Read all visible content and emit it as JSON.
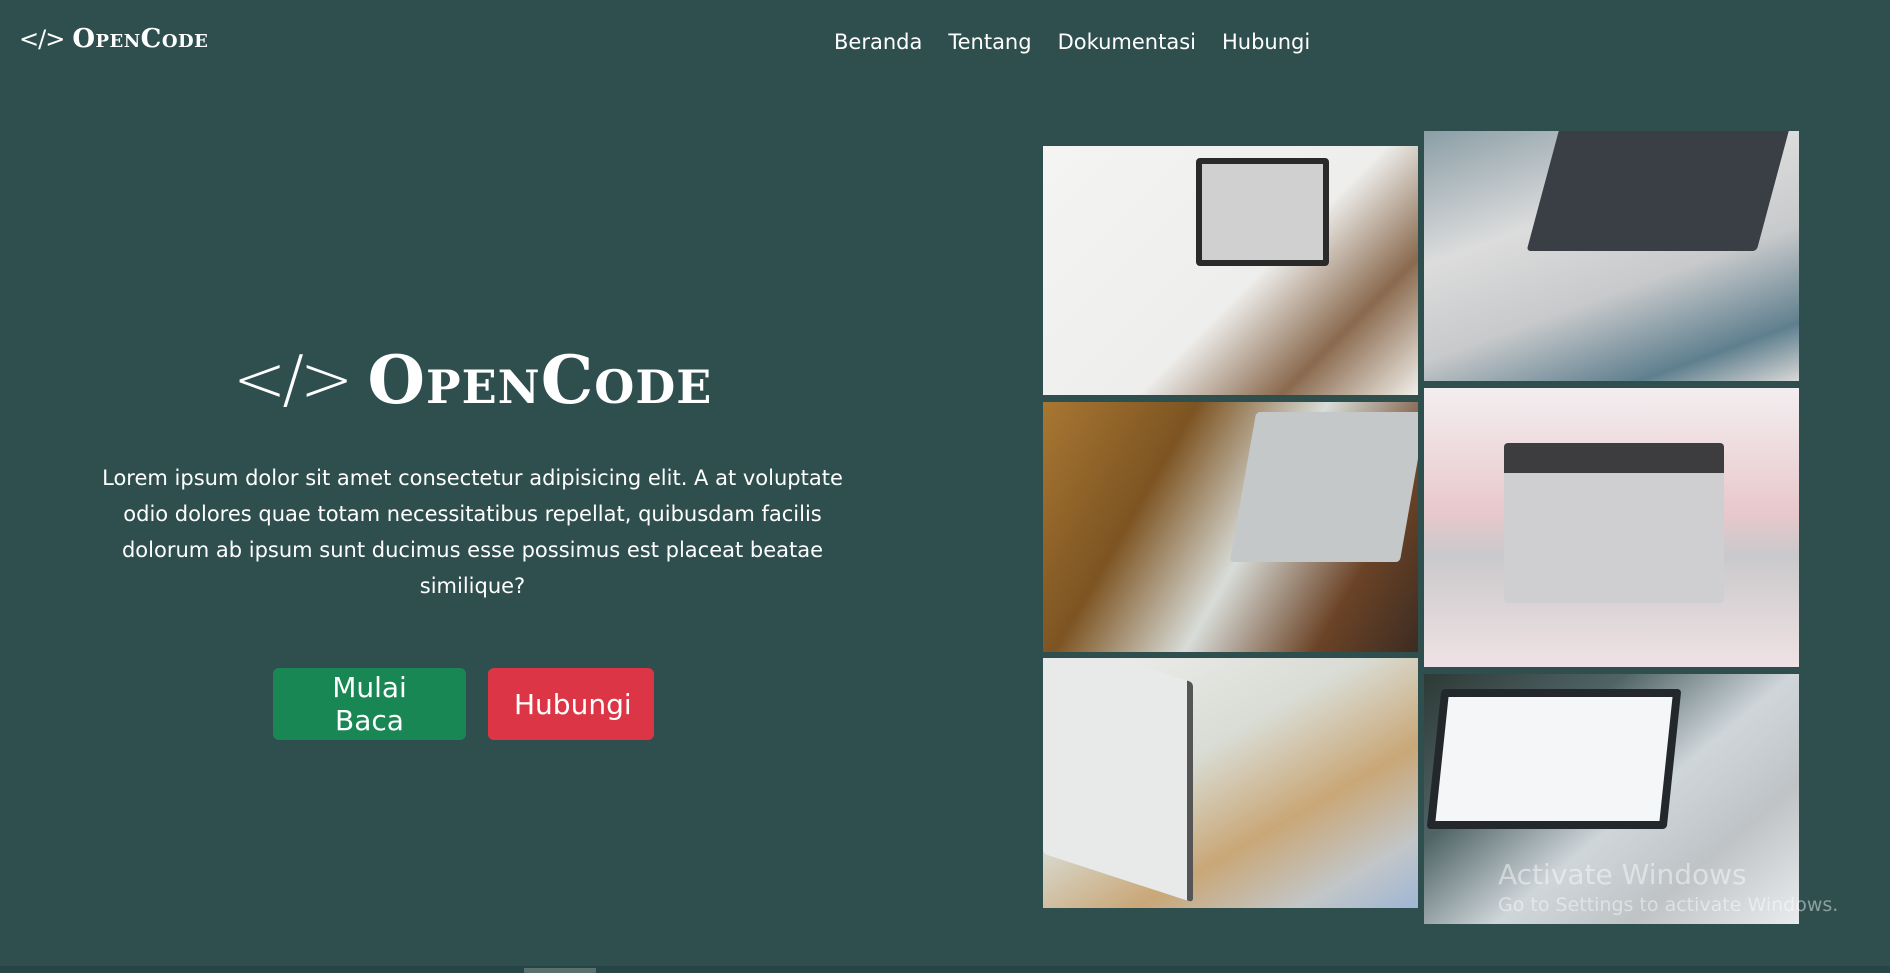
{
  "navbar": {
    "brand_icon": "</>",
    "brand_text": "OpenCode",
    "links": [
      "Beranda",
      "Tentang",
      "Dokumentasi",
      "Hubungi"
    ]
  },
  "hero": {
    "icon": "</>",
    "title": "OpenCode",
    "description": "Lorem ipsum dolor sit amet consectetur adipisicing elit. A at voluptate odio dolores quae totam necessitatibus repellat, quibusdam facilis dolorum ab ipsum sunt ducimus esse possimus est placeat beatae similique?",
    "primary_button": "Mulai Baca",
    "secondary_button": "Hubungi"
  },
  "gallery": {
    "photos": [
      "laptop-desk-photo",
      "laptop-typing-photo",
      "laptop-cafe-photo",
      "laptop-bed-coffee-photo",
      "laptop-office-photo",
      "laptop-website-photo"
    ]
  },
  "watermark": {
    "title": "Activate Windows",
    "subtitle": "Go to Settings to activate Windows."
  },
  "colors": {
    "background": "#2f4f4f",
    "primary_button": "#198754",
    "secondary_button": "#dc3545"
  }
}
